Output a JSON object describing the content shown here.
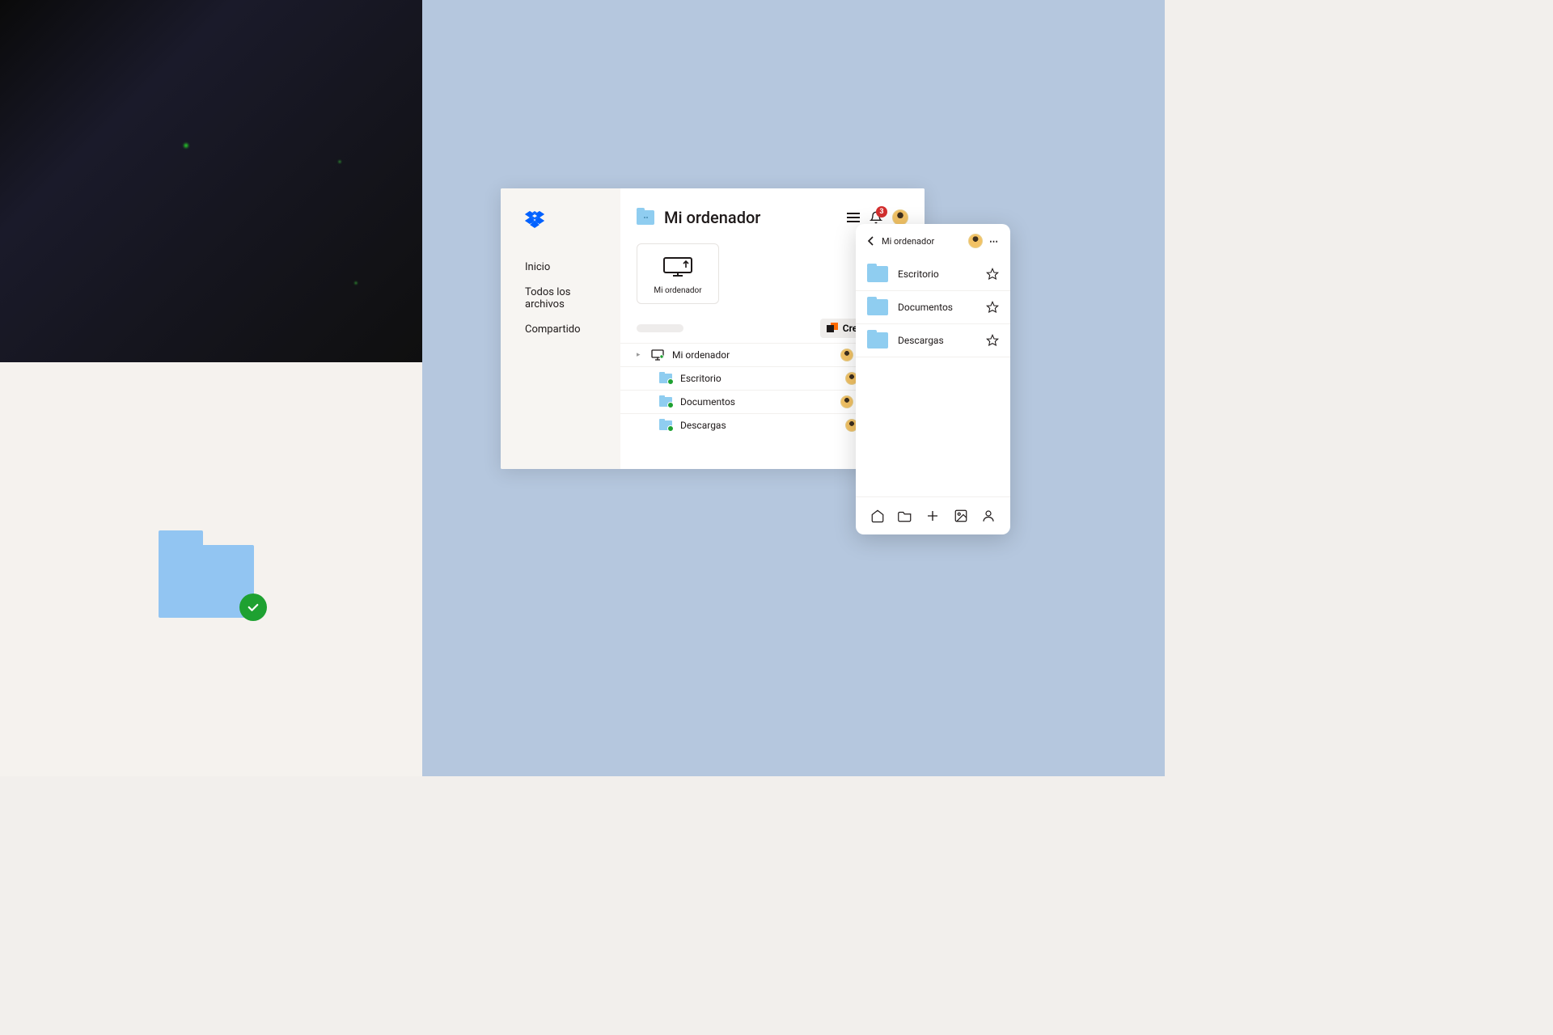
{
  "desktop": {
    "title": "Mi ordenador",
    "sidebar": {
      "items": [
        {
          "label": "Inicio"
        },
        {
          "label": "Todos los archivos"
        },
        {
          "label": "Compartido"
        }
      ]
    },
    "notification_count": "3",
    "computer_card_label": "Mi ordenador",
    "create_button": "Crear",
    "rows": [
      {
        "name": "Mi ordenador",
        "icon": "monitor"
      },
      {
        "name": "Escritorio",
        "icon": "folder"
      },
      {
        "name": "Documentos",
        "icon": "folder"
      },
      {
        "name": "Descargas",
        "icon": "folder"
      }
    ]
  },
  "mobile": {
    "title": "Mi ordenador",
    "rows": [
      {
        "name": "Escritorio"
      },
      {
        "name": "Documentos"
      },
      {
        "name": "Descargas"
      }
    ]
  }
}
